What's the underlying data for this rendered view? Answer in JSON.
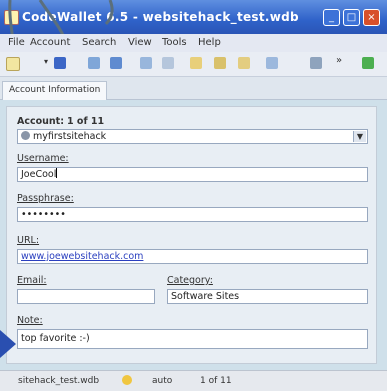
{
  "window": {
    "title": "CodeWallet 6.5 - websitehack_test.wdb",
    "minimize_glyph": "_",
    "maximize_glyph": "□",
    "close_glyph": "×"
  },
  "menu": {
    "items": [
      "File",
      "Account",
      "Search",
      "View",
      "Tools",
      "Help"
    ]
  },
  "toolbar": {
    "icons": [
      "new-icon",
      "dropdown-icon",
      "save-icon",
      "copy-icon",
      "paste-icon",
      "list-icon",
      "filter-icon",
      "folder-icon",
      "folder-add-icon",
      "folder-open-icon",
      "page-icon",
      "options-icon",
      "more-icon",
      "green-icon"
    ]
  },
  "tabs": {
    "active": "Account Information"
  },
  "form": {
    "account_label": "Account:",
    "account_position": "1 of 11",
    "account_value": "myfirstsitehack",
    "username_label": "Username:",
    "username_value": "JoeCool",
    "passphrase_label": "Passphrase:",
    "passphrase_value": "••••••••",
    "url_label": "URL:",
    "url_value": "www.joewebsitehack.com",
    "email_label": "Email:",
    "email_value": "",
    "category_label": "Category:",
    "category_value": "Software Sites",
    "note_label": "Note:",
    "note_value": "top favorite :-)"
  },
  "status": {
    "file": "sitehack_test.wdb",
    "mode": "auto",
    "position": "1 of 11"
  },
  "colors": {
    "titlebar": "#2f62c9",
    "close": "#d8502b",
    "link": "#2a3fbf"
  }
}
